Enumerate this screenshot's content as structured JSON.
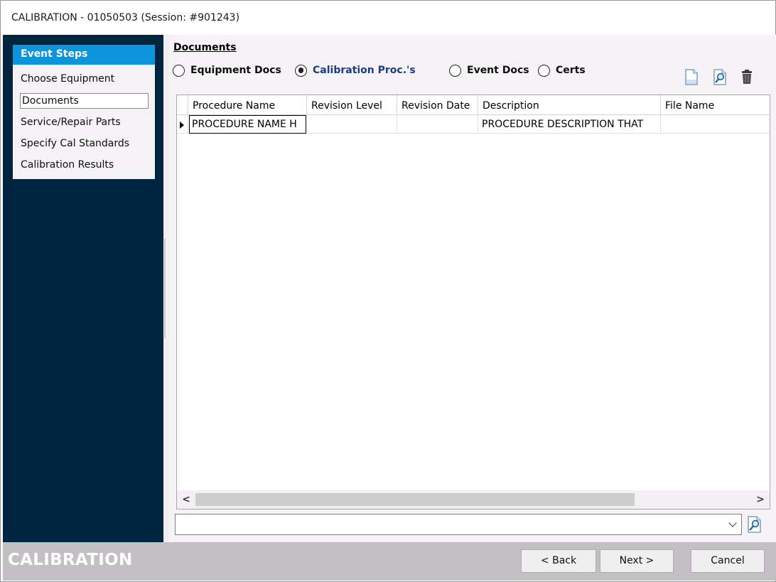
{
  "window": {
    "title": "CALIBRATION - 01050503 (Session: #901243)"
  },
  "sidebar": {
    "header": "Event Steps",
    "items": [
      {
        "label": "Choose Equipment",
        "selected": false
      },
      {
        "label": "Documents",
        "selected": true
      },
      {
        "label": "Service/Repair Parts",
        "selected": false
      },
      {
        "label": "Specify Cal Standards",
        "selected": false
      },
      {
        "label": "Calibration Results",
        "selected": false
      }
    ]
  },
  "documents": {
    "section_label": "Documents",
    "radio_options": [
      {
        "label": "Equipment Docs",
        "checked": false
      },
      {
        "label": "Calibration Proc.'s",
        "checked": true
      },
      {
        "label": "Event Docs",
        "checked": false
      },
      {
        "label": "Certs",
        "checked": false
      }
    ],
    "toolbar": [
      "new-document-icon",
      "view-document-icon",
      "delete-icon"
    ],
    "grid": {
      "columns": [
        "Procedure Name",
        "Revision Level",
        "Revision Date",
        "Description",
        "File Name"
      ],
      "rows": [
        [
          "PROCEDURE NAME H",
          "",
          "",
          "PROCEDURE DESCRIPTION THAT",
          ""
        ]
      ],
      "scroll_left_glyph": "<",
      "scroll_right_glyph": ">"
    },
    "filter": {
      "value": ""
    }
  },
  "footer": {
    "brand": "CALIBRATION",
    "back_label": "< Back",
    "next_label": "Next >",
    "cancel_label": "Cancel"
  },
  "colors": {
    "sidebar_bg": "#00263f",
    "sidebar_header_bg": "#0d95dc",
    "checked_radio_text": "#1b3c87",
    "footer_bg": "#c2c0c2"
  }
}
